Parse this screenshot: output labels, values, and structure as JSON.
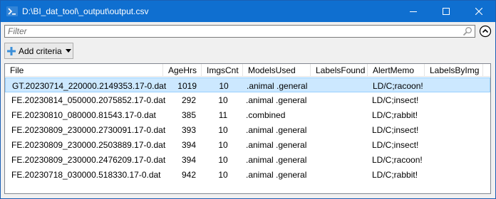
{
  "window": {
    "title": "D:\\BI_dat_tool\\_output\\output.csv",
    "accent": "#0f6fd0",
    "icon": "terminal-icon"
  },
  "filter": {
    "placeholder": "Filter",
    "value": "",
    "icon": "search-icon"
  },
  "toolbar": {
    "add_criteria_label": "Add criteria"
  },
  "table": {
    "columns": [
      "File",
      "AgeHrs",
      "ImgsCnt",
      "ModelsUsed",
      "LabelsFound",
      "AlertMemo",
      "LabelsByImg"
    ],
    "selected_row": 0,
    "selection_color": "#cce8ff",
    "rows": [
      {
        "file": "GT.20230714_220000.2149353.17-0.dat",
        "age": "1019",
        "imgs": "10",
        "models": ".animal .general",
        "labels": "",
        "memo": "LD/C;racoon!",
        "lbi": ""
      },
      {
        "file": "FE.20230814_050000.2075852.17-0.dat",
        "age": "292",
        "imgs": "10",
        "models": ".animal .general",
        "labels": "",
        "memo": "LD/C;insect!",
        "lbi": ""
      },
      {
        "file": "FE.20230810_080000.81543.17-0.dat",
        "age": "385",
        "imgs": "11",
        "models": ".combined",
        "labels": "",
        "memo": "LD/C;rabbit!",
        "lbi": ""
      },
      {
        "file": "FE.20230809_230000.2730091.17-0.dat",
        "age": "393",
        "imgs": "10",
        "models": ".animal .general",
        "labels": "",
        "memo": "LD/C;insect!",
        "lbi": ""
      },
      {
        "file": "FE.20230809_230000.2503889.17-0.dat",
        "age": "394",
        "imgs": "10",
        "models": ".animal .general",
        "labels": "",
        "memo": "LD/C;insect!",
        "lbi": ""
      },
      {
        "file": "FE.20230809_230000.2476209.17-0.dat",
        "age": "394",
        "imgs": "10",
        "models": ".animal .general",
        "labels": "",
        "memo": "LD/C;racoon!",
        "lbi": ""
      },
      {
        "file": "FE.20230718_030000.518330.17-0.dat",
        "age": "942",
        "imgs": "10",
        "models": ".animal .general",
        "labels": "",
        "memo": "LD/C;rabbit!",
        "lbi": ""
      }
    ]
  }
}
